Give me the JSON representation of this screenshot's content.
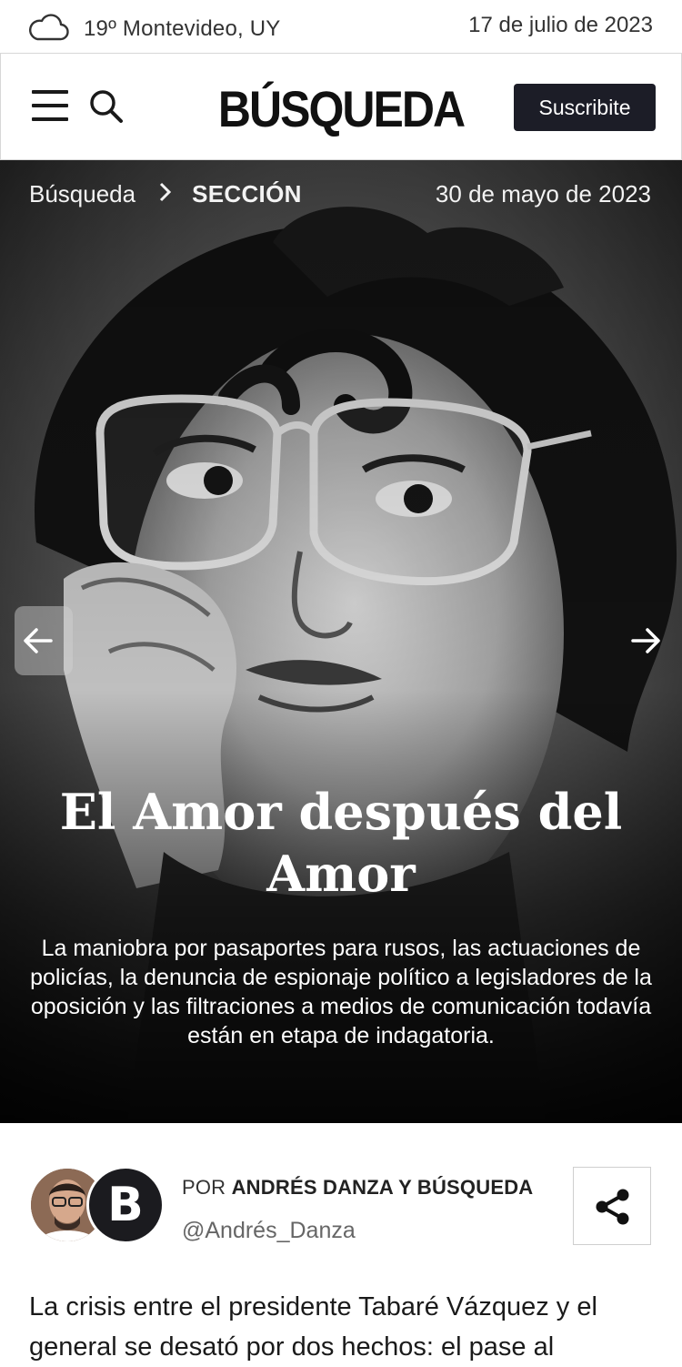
{
  "topbar": {
    "weather_icon": "cloud-icon",
    "weather": "19º Montevideo, UY",
    "date": "17 de julio de 2023"
  },
  "header": {
    "menu_icon": "hamburger-menu-icon",
    "search_icon": "search-icon",
    "logo": "BÚSQUEDA",
    "subscribe_label": "Suscribite",
    "subscribe_bg": "#1c1d27"
  },
  "hero": {
    "breadcrumb_home": "Búsqueda",
    "breadcrumb_section": "SECCIÓN",
    "date": "30 de mayo de 2023",
    "title": "El Amor después del Amor",
    "subtitle": "La maniobra por pasaportes para rusos, las actuaciones de policías, la denuncia de espionaje político a legisladores de la oposición y las filtraciones a medios de comunicación todavía están en etapa de indagatoria.",
    "prev_icon": "arrow-left-icon",
    "next_icon": "arrow-right-icon"
  },
  "author": {
    "by_prefix": "POR",
    "names": "ANDRÉS DANZA Y BÚSQUEDA",
    "handle": "@Andrés_Danza",
    "badge_letter": "B",
    "share_icon": "share-icon"
  },
  "article": {
    "lead": "La crisis entre el presidente Tabaré Vázquez y el general se desató por dos hechos: el pase al"
  }
}
